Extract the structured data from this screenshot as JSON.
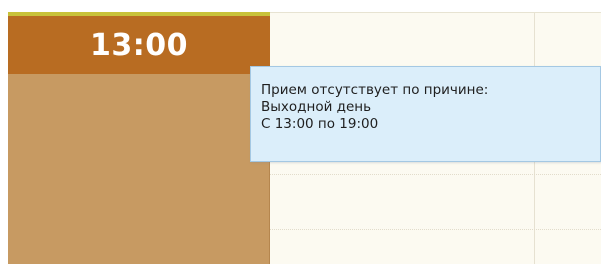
{
  "slot": {
    "time_label": "13:00"
  },
  "tooltip": {
    "line1": "Прием отсутствует по причине:",
    "line2": "Выходной день",
    "line3": "С 13:00 по 19:00"
  },
  "colors": {
    "slot_header": "#b86c22",
    "slot_body": "#c79a62",
    "top_accent": "#c8c23a",
    "grid_background": "#fcfaf1",
    "tooltip_background": "#dbeefa",
    "tooltip_border": "#a4c8e3"
  }
}
